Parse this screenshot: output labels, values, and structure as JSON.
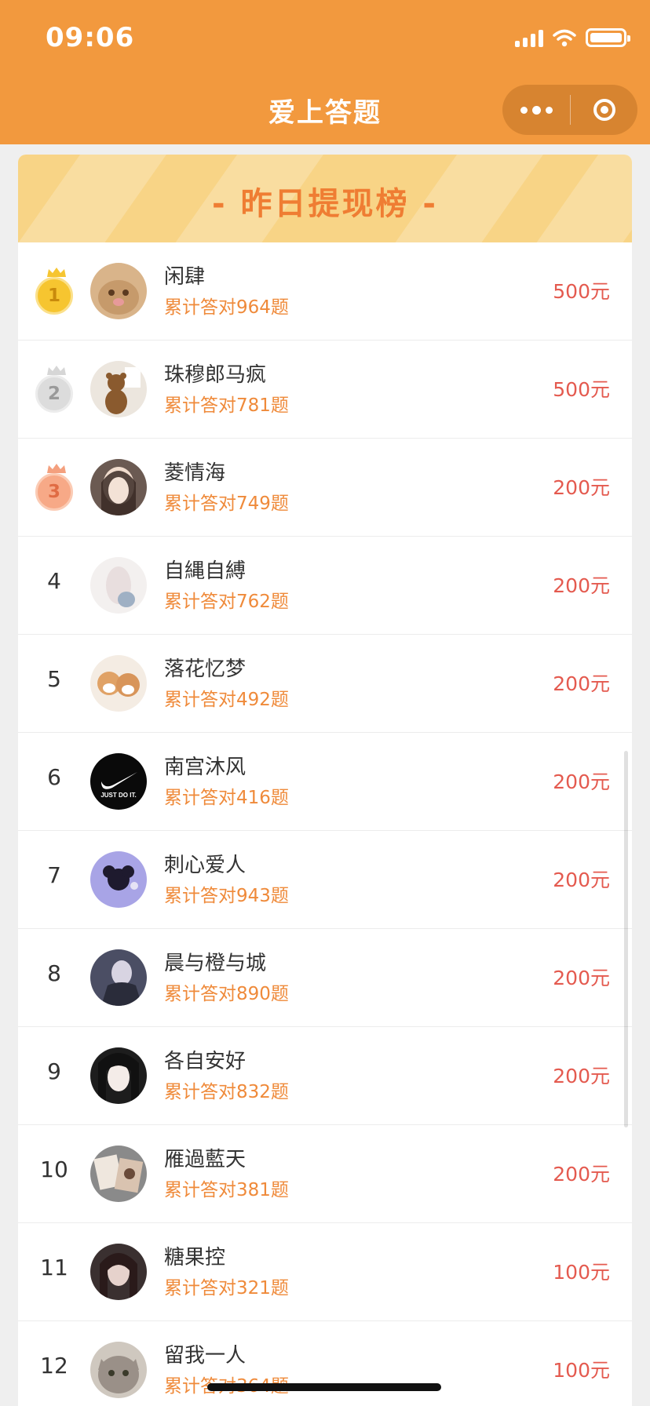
{
  "status_bar": {
    "time": "09:06",
    "signal_icon": "cellular-signal-icon",
    "wifi_icon": "wifi-icon",
    "battery_icon": "battery-icon"
  },
  "nav": {
    "title": "爱上答题",
    "more_icon": "more-dots-icon",
    "close_icon": "target-close-icon"
  },
  "board": {
    "title": "- 昨日提现榜 -"
  },
  "colors": {
    "header": "#f2993e",
    "banner": "#f8d486",
    "banner_title": "#ef7d33",
    "total_text": "#ef8a3a",
    "amount_text": "#e45a4f",
    "gold": "#f6c530",
    "silver": "#dcdcdc",
    "bronze": "#f7a987"
  },
  "rows": [
    {
      "rank": "1",
      "name": "闲肆",
      "total": "累计答对964题",
      "amount": "500元",
      "avatar": "cat-avatar"
    },
    {
      "rank": "2",
      "name": "珠穆郎马疯",
      "total": "累计答对781题",
      "amount": "500元",
      "avatar": "teddy-bear-avatar"
    },
    {
      "rank": "3",
      "name": "菱情海",
      "total": "累计答对749题",
      "amount": "200元",
      "avatar": "girl-portrait-avatar"
    },
    {
      "rank": "4",
      "name": "自縄自縛",
      "total": "累计答对762题",
      "amount": "200元",
      "avatar": "girl-with-plush-avatar"
    },
    {
      "rank": "5",
      "name": "落花忆梦",
      "total": "累计答对492题",
      "amount": "200元",
      "avatar": "shiba-dogs-avatar"
    },
    {
      "rank": "6",
      "name": "南宫沐风",
      "total": "累计答对416题",
      "amount": "200元",
      "avatar": "swoosh-logo-avatar"
    },
    {
      "rank": "7",
      "name": "刺心爱人",
      "total": "累计答对943题",
      "amount": "200元",
      "avatar": "purple-character-avatar"
    },
    {
      "rank": "8",
      "name": "晨与橙与城",
      "total": "累计答对890题",
      "amount": "200元",
      "avatar": "man-in-suit-avatar"
    },
    {
      "rank": "9",
      "name": "各自安好",
      "total": "累计答对832题",
      "amount": "200元",
      "avatar": "dark-hair-girl-avatar"
    },
    {
      "rank": "10",
      "name": "雁過藍天",
      "total": "累计答对381题",
      "amount": "200元",
      "avatar": "magazine-avatar"
    },
    {
      "rank": "11",
      "name": "糖果控",
      "total": "累计答对321题",
      "amount": "100元",
      "avatar": "dark-portrait-avatar"
    },
    {
      "rank": "12",
      "name": "留我一人",
      "total": "累计答对364题",
      "amount": "100元",
      "avatar": "grey-cat-avatar"
    }
  ]
}
